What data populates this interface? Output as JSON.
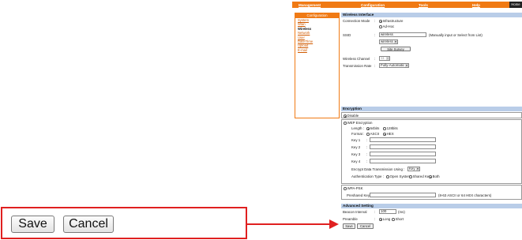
{
  "nav": {
    "items": [
      "Management",
      "Configuration",
      "Tools",
      "Help"
    ],
    "home": "Home"
  },
  "sidebar": {
    "title": "Configuration",
    "items": [
      "System",
      "Wlan",
      "Wireless",
      "Network",
      "User",
      "Date/Time",
      "Upload",
      "E-mail"
    ],
    "active_index": 2
  },
  "wireless_interface": {
    "title": "Wireless Interface",
    "connection_mode_label": "Connection Mode",
    "opt_infrastructure": "Infrastructure",
    "opt_adhoc": "Ad-Hoc",
    "ssid_label": "SSID",
    "ssid_value": "wireless",
    "ssid_hint": "(Manually input or Select from List)",
    "ssid_select": "wireless",
    "site_survey": "Site Survey",
    "channel_label": "Wireless Channel",
    "channel_value": "11",
    "rate_label": "Transmission Rate",
    "rate_value": "Fully-Automatic"
  },
  "encryption": {
    "title": "Encryption",
    "disable": "Disable",
    "wep": "WEP Encryption",
    "length_label": "Length :",
    "len_64": "64bits",
    "len_128": "128bits",
    "format_label": "Format :",
    "fmt_ascii": "ASCII",
    "fmt_hex": "HEX",
    "key1": "Key 1",
    "key2": "Key 2",
    "key3": "Key 3",
    "key4": "Key 4",
    "encrypt_label": "Encrypt Data Transmission Using :",
    "encrypt_value": "Key 1",
    "auth_label": "Authentication Type :",
    "auth_open": "Open System",
    "auth_shared": "Shared Key",
    "auth_both": "Both",
    "wpa": "WPA-PSK",
    "preshared_label": "Preshared Key:",
    "preshared_hint": "(8-63 ASCII or 64 HEX characters)"
  },
  "advanced": {
    "title": "Advanced Setting",
    "beacon_label": "Beacon Interval",
    "beacon_value": "100",
    "beacon_unit": "(ms)",
    "preamble_label": "Preamble",
    "pre_long": "Long",
    "pre_short": "Short"
  },
  "actions": {
    "save": "Save",
    "cancel": "Cancel"
  },
  "callout": {
    "save": "Save",
    "cancel": "Cancel"
  },
  "colors": {
    "accent": "#f07a14",
    "section": "#b9cde8",
    "callout": "#e02020"
  }
}
